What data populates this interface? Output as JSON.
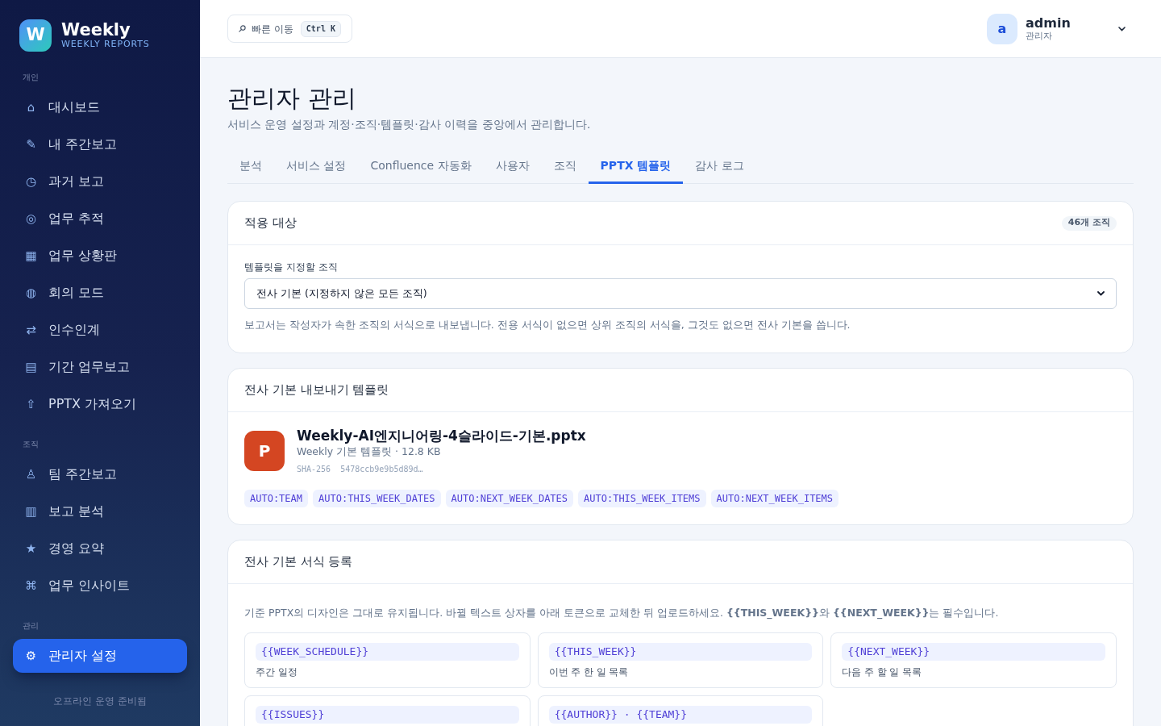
{
  "sidebar": {
    "logo": {
      "letter": "W",
      "title": "Weekly",
      "subtitle": "WEEKLY REPORTS"
    },
    "sections": [
      {
        "label": "개인",
        "items": [
          {
            "icon": "⌂",
            "label": "대시보드",
            "selected": false
          },
          {
            "icon": "✎",
            "label": "내 주간보고",
            "selected": false
          },
          {
            "icon": "◷",
            "label": "과거 보고",
            "selected": false
          },
          {
            "icon": "◎",
            "label": "업무 추적",
            "selected": false
          },
          {
            "icon": "▦",
            "label": "업무 상황판",
            "selected": false
          },
          {
            "icon": "◍",
            "label": "회의 모드",
            "selected": false
          },
          {
            "icon": "⇄",
            "label": "인수인계",
            "selected": false
          },
          {
            "icon": "▤",
            "label": "기간 업무보고",
            "selected": false
          },
          {
            "icon": "⇧",
            "label": "PPTX 가져오기",
            "selected": false
          }
        ]
      },
      {
        "label": "조직",
        "items": [
          {
            "icon": "♙",
            "label": "팀 주간보고",
            "selected": false
          },
          {
            "icon": "▥",
            "label": "보고 분석",
            "selected": false
          },
          {
            "icon": "★",
            "label": "경영 요약",
            "selected": false
          },
          {
            "icon": "⌘",
            "label": "업무 인사이트",
            "selected": false
          }
        ]
      },
      {
        "label": "관리",
        "items": [
          {
            "icon": "⚙",
            "label": "관리자 설정",
            "selected": true
          }
        ]
      }
    ],
    "footer": "오프라인 운영 준비됨"
  },
  "topbar": {
    "search": {
      "label": "빠른 이동",
      "shortcut": "Ctrl K"
    },
    "user": {
      "avatar": "a",
      "name": "admin",
      "role": "관리자"
    }
  },
  "page": {
    "title": "관리자 관리",
    "subtitle": "서비스 운영 설정과 계정·조직·템플릿·감사 이력을 중앙에서 관리합니다."
  },
  "tabs": [
    {
      "label": "분석",
      "selected": false
    },
    {
      "label": "서비스 설정",
      "selected": false
    },
    {
      "label": "Confluence 자동화",
      "selected": false
    },
    {
      "label": "사용자",
      "selected": false
    },
    {
      "label": "조직",
      "selected": false
    },
    {
      "label": "PPTX 템플릿",
      "selected": true
    },
    {
      "label": "감사 로그",
      "selected": false
    }
  ],
  "target_card": {
    "title": "적용 대상",
    "badge": "46개 조직",
    "field_label": "템플릿을 지정할 조직",
    "select_value": "전사 기본 (지정하지 않은 모든 조직)",
    "help": "보고서는 작성자가 속한 조직의 서식으로 내보냅니다. 전용 서식이 없으면 상위 조직의 서식을, 그것도 없으면 전사 기본을 씁니다."
  },
  "template_card": {
    "title": "전사 기본 내보내기 템플릿",
    "file": {
      "icon_letter": "P",
      "name": "Weekly-AI엔지니어링-4슬라이드-기본.pptx",
      "meta": "Weekly 기본 템플릿 · 12.8 KB",
      "hash": "SHA-256  5478ccb9e9b5d89d…"
    },
    "tags": [
      "AUTO:TEAM",
      "AUTO:THIS_WEEK_DATES",
      "AUTO:NEXT_WEEK_DATES",
      "AUTO:THIS_WEEK_ITEMS",
      "AUTO:NEXT_WEEK_ITEMS"
    ]
  },
  "format_card": {
    "title": "전사 기본 서식 등록",
    "intro": "기준 PPTX의 디자인은 그대로 유지됩니다. 바뀔 텍스트 상자를 아래 토큰으로 교체한 뒤 업로드하세요. **{{THIS_WEEK}}**와 **{{NEXT_WEEK}}**는 필수입니다.",
    "tokens": [
      {
        "token": "{{WEEK_SCHEDULE}}",
        "description": "주간 일정"
      },
      {
        "token": "{{THIS_WEEK}}",
        "description": "이번 주 한 일 목록"
      },
      {
        "token": "{{NEXT_WEEK}}",
        "description": "다음 주 할 일 목록"
      },
      {
        "token": "{{ISSUES}}"
      },
      {
        "token": "{{AUTHOR}} · {{TEAM}}"
      }
    ]
  }
}
